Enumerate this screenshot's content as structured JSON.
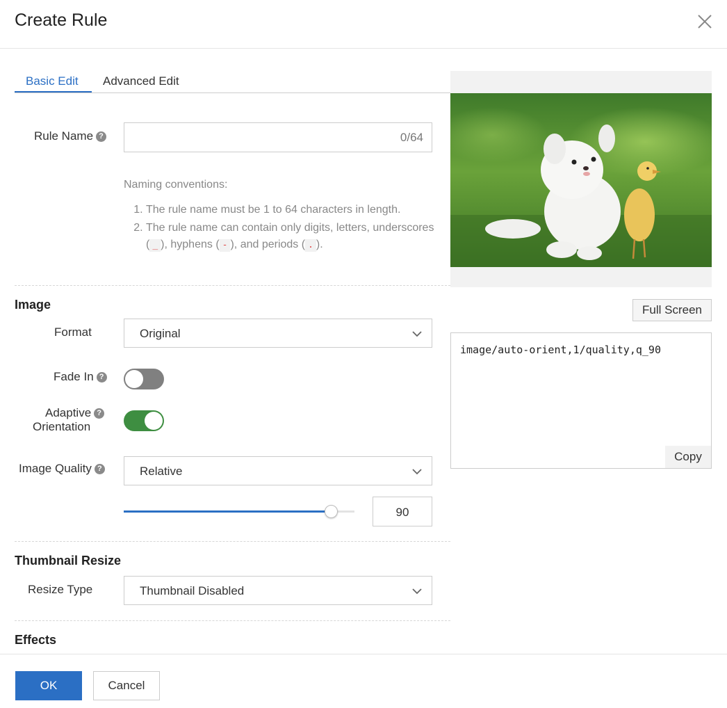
{
  "dialog": {
    "title": "Create Rule"
  },
  "tabs": [
    {
      "label": "Basic Edit",
      "active": true
    },
    {
      "label": "Advanced Edit",
      "active": false
    }
  ],
  "rule_name": {
    "label": "Rule Name",
    "value": "",
    "counter": "0/64",
    "hint_title": "Naming conventions:",
    "hint_1": "The rule name must be 1 to 64 characters in length.",
    "hint_2_prefix": "The rule name can contain only digits, letters, underscores (",
    "hint_2_code_1": "_",
    "hint_2_mid_1": "), hyphens (",
    "hint_2_code_2": "-",
    "hint_2_mid_2": "), and periods (",
    "hint_2_code_3": ".",
    "hint_2_suffix": ")."
  },
  "image": {
    "section_title": "Image",
    "format_label": "Format",
    "format_value": "Original",
    "fade_in_label": "Fade In",
    "fade_in_on": false,
    "adaptive_label_1": "Adaptive",
    "adaptive_label_2": "Orientation",
    "adaptive_on": true,
    "quality_label": "Image Quality",
    "quality_mode": "Relative",
    "quality_value": "90",
    "quality_slider_fraction": 0.9
  },
  "thumbnail": {
    "section_title": "Thumbnail Resize",
    "resize_label": "Resize Type",
    "resize_value": "Thumbnail Disabled"
  },
  "effects": {
    "section_title": "Effects"
  },
  "preview": {
    "fullscreen_label": "Full Screen",
    "code": "image/auto-orient,1/quality,q_90",
    "copy_label": "Copy"
  },
  "footer": {
    "ok_label": "OK",
    "cancel_label": "Cancel"
  },
  "colors": {
    "accent": "#2b6fc4",
    "toggle_on": "#3e8e41",
    "toggle_off": "#808080"
  },
  "icons": [
    "close-icon",
    "help-icon",
    "chevron-down-icon"
  ]
}
